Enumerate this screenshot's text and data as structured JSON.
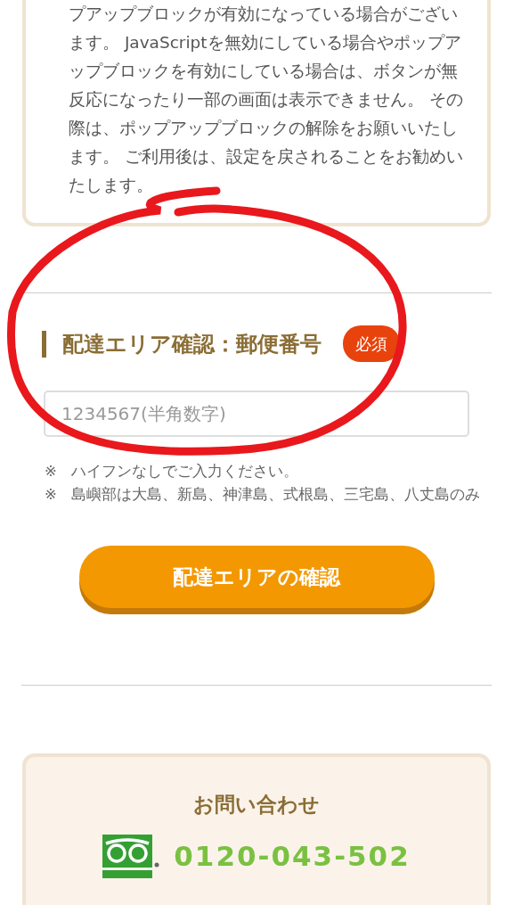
{
  "notice": {
    "text": "プアップブロックが有効になっている場合がございます。 JavaScriptを無効にしている場合やポップアップブロックを有効にしている場合は、ボタンが無反応になったり一部の画面は表示できません。 その際は、ポップアップブロックの解除をお願いいたします。 ご利用後は、設定を戻されることをお勧めいたします。"
  },
  "postal_section": {
    "heading": "配達エリア確認：郵便番号",
    "badge": "必須",
    "placeholder": "1234567(半角数字)",
    "notes": [
      {
        "mark": "※",
        "text": "ハイフンなしでご入力ください。"
      },
      {
        "mark": "※",
        "text": "島嶼部は大島、新島、神津島、式根島、三宅島、八丈島のみ"
      }
    ],
    "button": "配達エリアの確認"
  },
  "contact": {
    "title": "お問い合わせ",
    "phone": "0120-043-502"
  },
  "annotation": {
    "kind": "circle"
  }
}
